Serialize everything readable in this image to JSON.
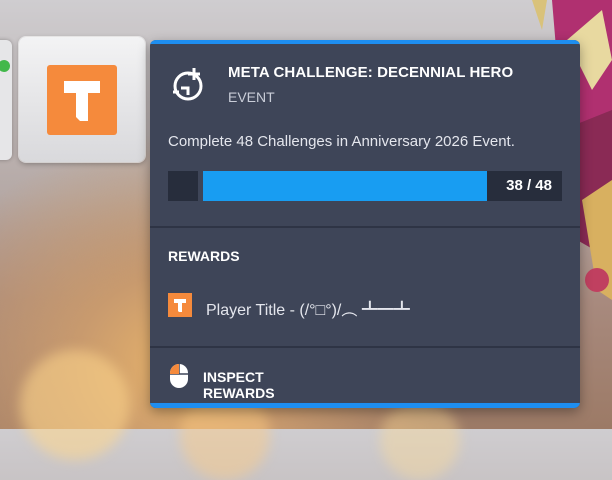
{
  "challenge": {
    "title": "META CHALLENGE: DECENNIAL HERO",
    "category": "EVENT",
    "description": "Complete 48 Challenges in Anniversary 2026 Event.",
    "progress_text": "38 / 48",
    "progress_current": 38,
    "progress_total": 48
  },
  "rewards": {
    "heading": "REWARDS",
    "items": [
      {
        "label": "Player Title - (/°□°)/︵ ┻━┻",
        "icon": "title-icon"
      }
    ]
  },
  "actions": {
    "inspect_label": "INSPECT REWARDS",
    "inspect_icon": "mouse-icon"
  },
  "colors": {
    "accent": "#1e8ef0",
    "progress_fill": "#189df2",
    "panel": "#3e4558",
    "title_icon_orange": "#f58a3c"
  }
}
